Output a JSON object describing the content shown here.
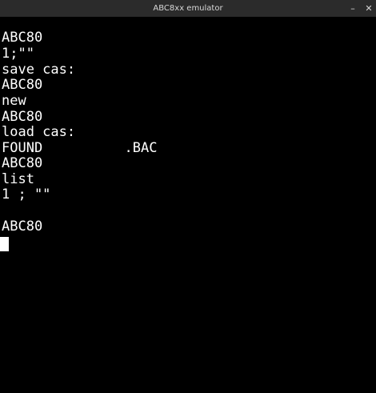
{
  "window": {
    "title": "ABC8xx emulator",
    "minimize_glyph": "–",
    "close_glyph": "✕"
  },
  "terminal": {
    "lines": [
      "ABC80",
      "1;\"\"",
      "save cas:",
      "ABC80",
      "new",
      "ABC80",
      "load cas:",
      "FOUND          .BAC",
      "ABC80",
      "list",
      "1 ; \"\"",
      "",
      "ABC80"
    ]
  },
  "colors": {
    "background": "#000000",
    "text": "#ffffff",
    "titlebar": "#2b2b2b"
  }
}
